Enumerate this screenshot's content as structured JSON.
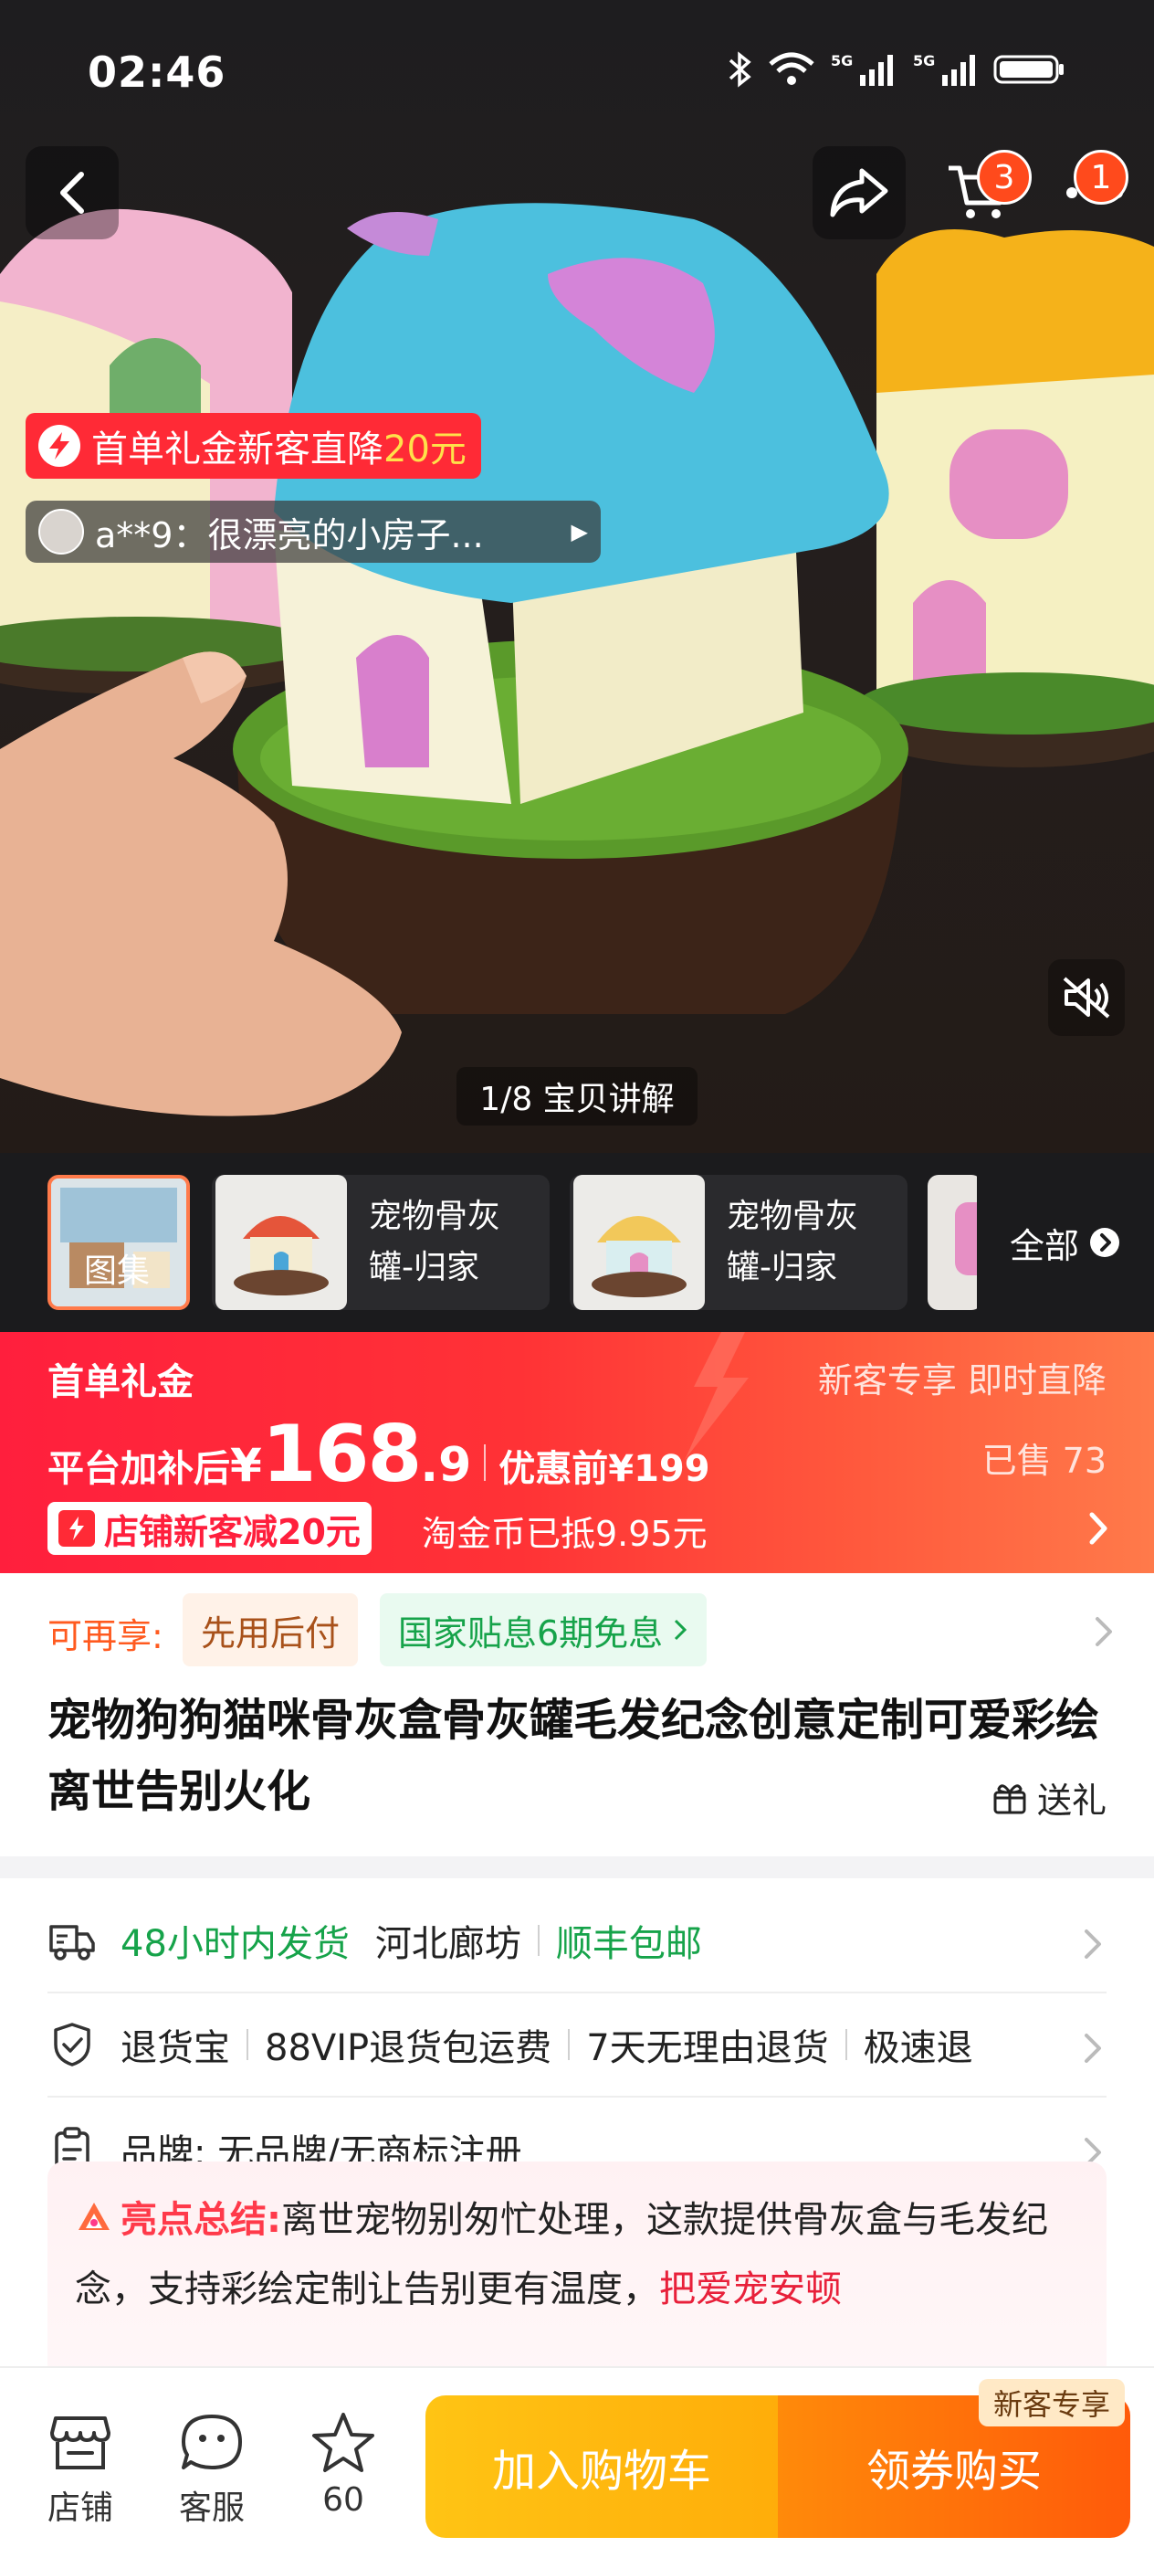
{
  "status_bar": {
    "time": "02:46",
    "network_1": "5G",
    "network_2": "5G"
  },
  "header": {
    "cart_count": "3",
    "message_count": "1"
  },
  "hero": {
    "promo_text": "首单礼金新客直降",
    "promo_amount": "20元",
    "review_text": "a**9：很漂亮的小房子...",
    "video_label": "1/8 宝贝讲解"
  },
  "thumbnails": [
    {
      "label": "图集"
    },
    {
      "label_line1": "宠物骨灰",
      "label_line2": "罐-归家"
    },
    {
      "label_line1": "宠物骨灰",
      "label_line2": "罐-归家"
    }
  ],
  "all_label": "全部",
  "price": {
    "left_title": "首单礼金",
    "right_title": "新客专享 即时直降",
    "after_label": "平台加补后",
    "currency": "¥",
    "price_int": "168",
    "price_dec": ".9",
    "before_label": "优惠前¥199",
    "sold": "已售 73",
    "shop_tag": "店铺新客减20元",
    "coin_text": "淘金币已抵9.95元"
  },
  "info": {
    "label": "可再享:",
    "tag_pay_later": "先用后付",
    "tag_installment": "国家贴息6期免息",
    "title": "宠物狗狗猫咪骨灰盒骨灰罐毛发纪念创意定制可爱彩绘离世告别火化",
    "gift_label": "送礼"
  },
  "service": {
    "shipping_time": "48小时内发货",
    "shipping_from": "河北廊坊",
    "shipping_free": "顺丰包邮",
    "return_1": "退货宝",
    "return_2": "88VIP退货包运费",
    "return_3": "7天无理由退货",
    "return_4": "极速退",
    "brand": "品牌: 无品牌/无商标注册"
  },
  "highlight": {
    "label": "亮点总结:",
    "text": "离世宠物别匆忙处理，这款提供骨灰盒与毛发纪念，支持彩绘定制让告别更有温度，",
    "red_text": "把爱宠安顿"
  },
  "bottom_bar": {
    "shop": "店铺",
    "service": "客服",
    "favorites": "60",
    "add_to_cart": "加入购物车",
    "buy": "领券购买",
    "new_customer_badge": "新客专享"
  },
  "colors": {
    "accent_red": "#ff1f3d",
    "promo_yellow": "#ffe14a",
    "green": "#16a34a",
    "cart_button": "#ffc414",
    "buy_button": "#ff5a0a"
  }
}
